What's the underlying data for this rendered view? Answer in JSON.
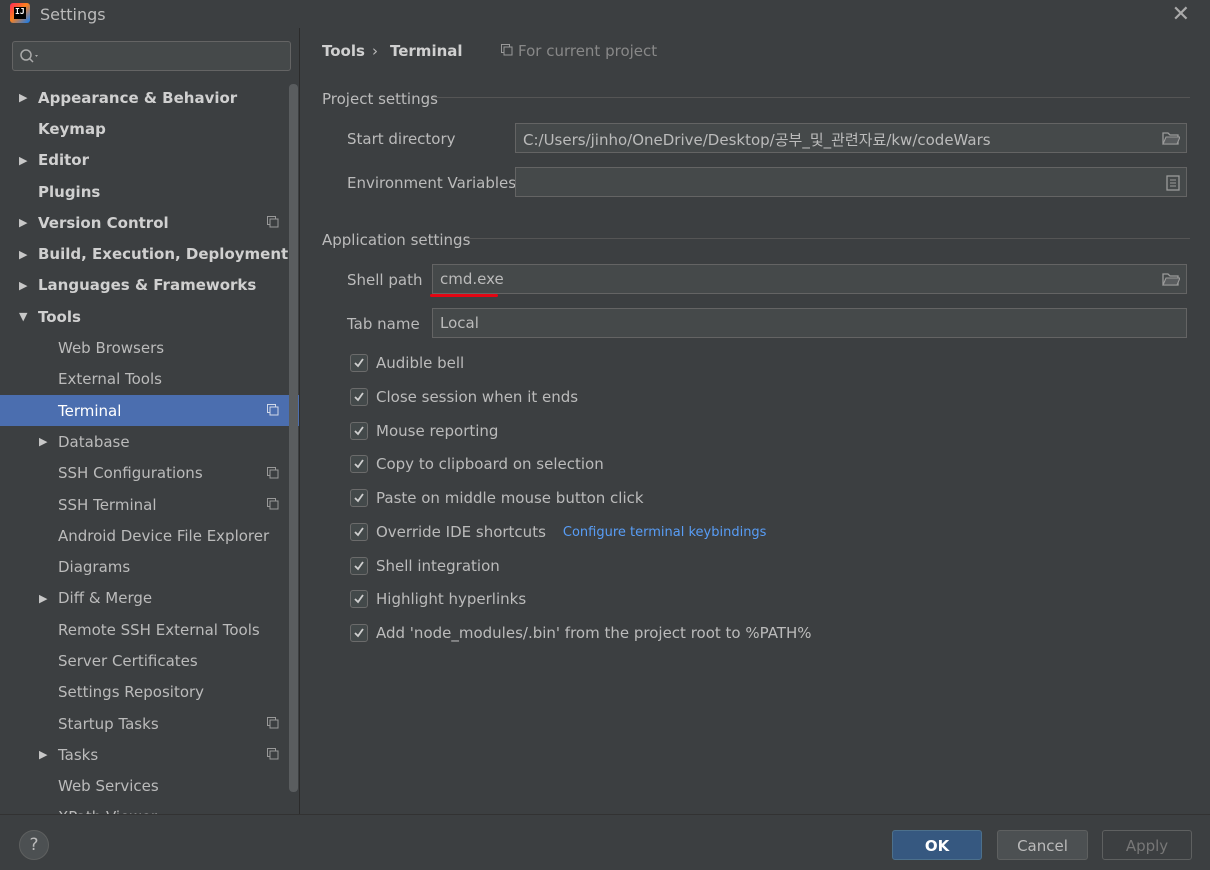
{
  "window": {
    "title": "Settings",
    "app_icon_text": "IJ"
  },
  "search": {
    "placeholder": ""
  },
  "tree": [
    {
      "label": "Appearance & Behavior",
      "level": 0,
      "expandable": true,
      "expanded": false,
      "project": false
    },
    {
      "label": "Keymap",
      "level": 0,
      "expandable": false,
      "project": false
    },
    {
      "label": "Editor",
      "level": 0,
      "expandable": true,
      "expanded": false,
      "project": false
    },
    {
      "label": "Plugins",
      "level": 0,
      "expandable": false,
      "project": false
    },
    {
      "label": "Version Control",
      "level": 0,
      "expandable": true,
      "expanded": false,
      "project": true
    },
    {
      "label": "Build, Execution, Deployment",
      "level": 0,
      "expandable": true,
      "expanded": false,
      "project": false
    },
    {
      "label": "Languages & Frameworks",
      "level": 0,
      "expandable": true,
      "expanded": false,
      "project": false
    },
    {
      "label": "Tools",
      "level": 0,
      "expandable": true,
      "expanded": true,
      "project": false
    },
    {
      "label": "Web Browsers",
      "level": 1,
      "expandable": false,
      "project": false
    },
    {
      "label": "External Tools",
      "level": 1,
      "expandable": false,
      "project": false
    },
    {
      "label": "Terminal",
      "level": 1,
      "expandable": false,
      "project": true,
      "selected": true
    },
    {
      "label": "Database",
      "level": 1,
      "expandable": true,
      "expanded": false,
      "project": false
    },
    {
      "label": "SSH Configurations",
      "level": 1,
      "expandable": false,
      "project": true
    },
    {
      "label": "SSH Terminal",
      "level": 1,
      "expandable": false,
      "project": true
    },
    {
      "label": "Android Device File Explorer",
      "level": 1,
      "expandable": false,
      "project": false
    },
    {
      "label": "Diagrams",
      "level": 1,
      "expandable": false,
      "project": false
    },
    {
      "label": "Diff & Merge",
      "level": 1,
      "expandable": true,
      "expanded": false,
      "project": false
    },
    {
      "label": "Remote SSH External Tools",
      "level": 1,
      "expandable": false,
      "project": false
    },
    {
      "label": "Server Certificates",
      "level": 1,
      "expandable": false,
      "project": false
    },
    {
      "label": "Settings Repository",
      "level": 1,
      "expandable": false,
      "project": false
    },
    {
      "label": "Startup Tasks",
      "level": 1,
      "expandable": false,
      "project": true
    },
    {
      "label": "Tasks",
      "level": 1,
      "expandable": true,
      "expanded": false,
      "project": true
    },
    {
      "label": "Web Services",
      "level": 1,
      "expandable": false,
      "project": false
    },
    {
      "label": "XPath Viewer",
      "level": 1,
      "expandable": false,
      "project": false
    }
  ],
  "breadcrumb": {
    "parent": "Tools",
    "separator": "›",
    "current": "Terminal",
    "scope": "For current project"
  },
  "project_settings": {
    "title": "Project settings",
    "start_directory_label": "Start directory",
    "start_directory_value": "C:/Users/jinho/OneDrive/Desktop/공부_및_관련자료/kw/codeWars",
    "env_vars_label": "Environment Variables",
    "env_vars_value": ""
  },
  "application_settings": {
    "title": "Application settings",
    "shell_path_label": "Shell path",
    "shell_path_value": "cmd.exe",
    "tab_name_label": "Tab name",
    "tab_name_value": "Local"
  },
  "checkboxes": [
    {
      "label": "Audible bell",
      "checked": true
    },
    {
      "label": "Close session when it ends",
      "checked": true
    },
    {
      "label": "Mouse reporting",
      "checked": true
    },
    {
      "label": "Copy to clipboard on selection",
      "checked": true
    },
    {
      "label": "Paste on middle mouse button click",
      "checked": true
    },
    {
      "label": "Override IDE shortcuts",
      "checked": true,
      "link": "Configure terminal keybindings"
    },
    {
      "label": "Shell integration",
      "checked": true
    },
    {
      "label": "Highlight hyperlinks",
      "checked": true
    },
    {
      "label": "Add 'node_modules/.bin' from the project root to %PATH%",
      "checked": true
    }
  ],
  "buttons": {
    "help": "?",
    "ok": "OK",
    "cancel": "Cancel",
    "apply": "Apply"
  },
  "colors": {
    "accent_selected": "#4b6eaf",
    "link": "#589df6",
    "annotation_underline": "#e30613"
  }
}
